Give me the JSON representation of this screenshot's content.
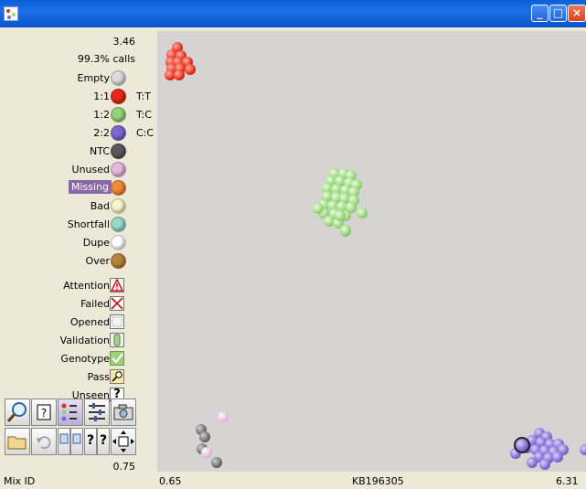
{
  "window": {
    "title": ""
  },
  "stats": {
    "value": "3.46",
    "calls": "99.3% calls",
    "bottom_value": "0.75"
  },
  "legend": [
    {
      "label": "Empty",
      "gt": "",
      "color": "#dcdcdc"
    },
    {
      "label": "1:1",
      "gt": "T:T",
      "color": "#e62a1a"
    },
    {
      "label": "1:2",
      "gt": "T:C",
      "color": "#96d47a"
    },
    {
      "label": "2:2",
      "gt": "C:C",
      "color": "#7c6ad0"
    },
    {
      "label": "NTC",
      "gt": "",
      "color": "#5a5a5a"
    },
    {
      "label": "Unused",
      "gt": "",
      "color": "#e8b8e0"
    },
    {
      "label": "Missing",
      "gt": "",
      "color": "#f28a3a"
    },
    {
      "label": "Bad",
      "gt": "",
      "color": "#fbf6c8"
    },
    {
      "label": "Shortfall",
      "gt": "",
      "color": "#9ad8c8"
    },
    {
      "label": "Dupe",
      "gt": "",
      "color": "#ffffff"
    },
    {
      "label": "Over",
      "gt": "",
      "color": "#b8863a"
    }
  ],
  "statuses": [
    {
      "label": "Attention",
      "icon": "attention-icon"
    },
    {
      "label": "Failed",
      "icon": "failed-icon"
    },
    {
      "label": "Opened",
      "icon": "opened-icon"
    },
    {
      "label": "Validation",
      "icon": "validation-icon"
    },
    {
      "label": "Genotype",
      "icon": "genotype-icon"
    },
    {
      "label": "Pass",
      "icon": "pass-icon"
    },
    {
      "label": "Unseen",
      "icon": "unseen-icon"
    }
  ],
  "footer": {
    "left": "Mix ID",
    "x_min": "0.65",
    "assay": "KB196305",
    "x_max": "6.31"
  },
  "colors": {
    "titlebar": "#1d6fe8",
    "plot_bg": "#d6d3d3",
    "highlight": "#8a6aa6"
  }
}
